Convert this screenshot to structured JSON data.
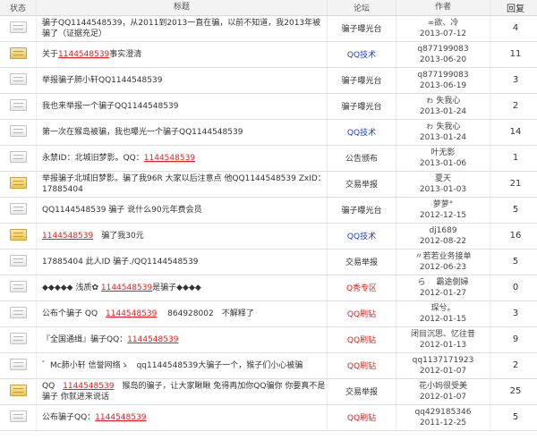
{
  "header": {
    "status": "状态",
    "title": "标题",
    "forum": "论坛",
    "author": "作者",
    "replies": "回复"
  },
  "colors": {
    "highlight": "#e0201e",
    "forum_blue": "#1b3fc8",
    "forum_red": "#e0201e"
  },
  "rows": [
    {
      "icon": "document-icon",
      "title_pre": "骗子QQ1144548539，从2011到2013一直在骗，以前不知道，我2013年被骗了（证据充足）",
      "title_hl": "",
      "title_post": "",
      "forum": "骗子曝光台",
      "forum_color": "dark",
      "author": "∞欲、冷",
      "date": "2013-07-12",
      "replies": "4"
    },
    {
      "icon": "folder-icon",
      "title_pre": "关于",
      "title_hl": "1144548539",
      "title_post": "事实澄清",
      "forum": "QQ技术",
      "forum_color": "blue",
      "author": "q877199083",
      "date": "2013-06-20",
      "replies": "11"
    },
    {
      "icon": "document-icon",
      "title_pre": "举报骗子肺小轩QQ1144548539",
      "title_hl": "",
      "title_post": "",
      "forum": "骗子曝光台",
      "forum_color": "dark",
      "author": "q877199083",
      "date": "2013-06-19",
      "replies": "3"
    },
    {
      "icon": "document-icon",
      "title_pre": "我也来举报一个骗子QQ1144548539",
      "title_hl": "",
      "title_post": "",
      "forum": "骗子曝光台",
      "forum_color": "dark",
      "author": "ゎ 失我心",
      "date": "2013-01-24",
      "replies": "2"
    },
    {
      "icon": "document-icon",
      "title_pre": "第一次在猴岛被骗，我也曝光一个骗子QQ1144548539",
      "title_hl": "",
      "title_post": "",
      "forum": "QQ技术",
      "forum_color": "blue",
      "author": "ゎ 失我心",
      "date": "2013-01-24",
      "replies": "14"
    },
    {
      "icon": "document-icon",
      "title_pre": "永禁ID：北城旧梦影。QQ：",
      "title_hl": "1144548539",
      "title_post": "",
      "forum": "公告颁布",
      "forum_color": "dark",
      "author": "叶无影",
      "date": "2013-01-06",
      "replies": "1"
    },
    {
      "icon": "folder-icon",
      "title_pre": "举报骗子北城旧梦影。骗了我96R 大家以后注意点 他QQ1144548539 ZxID：17885404",
      "title_hl": "",
      "title_post": "",
      "forum": "交易举报",
      "forum_color": "dark",
      "author": "夏天",
      "date": "2013-01-03",
      "replies": "21"
    },
    {
      "icon": "document-icon",
      "title_pre": "QQ1144548539 骗子 说什么90元年费会员",
      "title_hl": "",
      "title_post": "",
      "forum": "骗子曝光台",
      "forum_color": "dark",
      "author": "萝萝°",
      "date": "2012-12-15",
      "replies": "5"
    },
    {
      "icon": "folder-icon",
      "title_pre": "",
      "title_hl": "1144548539",
      "title_post": "　骗了我30元",
      "forum": "QQ技术",
      "forum_color": "blue",
      "author": "dj1689",
      "date": "2012-08-22",
      "replies": "16"
    },
    {
      "icon": "document-icon",
      "title_pre": "17885404 此人ID 骗子./QQ1144548539",
      "title_hl": "",
      "title_post": "",
      "forum": "交易举报",
      "forum_color": "dark",
      "author": "〃若若业务接单",
      "date": "2012-06-23",
      "replies": "5"
    },
    {
      "icon": "document-icon",
      "title_pre": "◆◆◆◆◆ 浅质✿ ",
      "title_hl": "1144548539",
      "title_post": "是骗子◆◆◆◆",
      "forum": "Q秀专区",
      "forum_color": "red",
      "author": "ら　 霸途側婦",
      "date": "2012-01-27",
      "replies": "0"
    },
    {
      "icon": "document-icon",
      "title_pre": "公布个骗子 QQ　",
      "title_hl": "1144548539",
      "title_post": "　 864928002　不解释了",
      "forum": "QQ刷钻",
      "forum_color": "red",
      "author": "琛兮。",
      "date": "2012-01-15",
      "replies": "3"
    },
    {
      "icon": "document-icon",
      "title_pre": "『全国通缉』骗子QQ：",
      "title_hl": "1144548539",
      "title_post": "",
      "forum": "QQ刷钻",
      "forum_color": "red",
      "author": "闭目沉思、忆往昔",
      "date": "2012-01-13",
      "replies": "9"
    },
    {
      "icon": "person-icon",
      "title_pre": "゛Mc肺小轩 信誉网络ゝ　qq1144548539大骗子一个，猴子们小心被骗",
      "title_hl": "",
      "title_post": "",
      "forum": "QQ刷钻",
      "forum_color": "red",
      "author": "qq1137171923",
      "date": "2012-01-07",
      "replies": "2"
    },
    {
      "icon": "folder-icon",
      "title_pre": "QQ　",
      "title_hl": "1144548539",
      "title_post": "　猴岛的骗子，让大家瞅瞅 免得再加你QQ骗你 你要真不是骗子 你就进来说话",
      "forum": "交易举报",
      "forum_color": "dark",
      "author": "花小妈很受美",
      "date": "2012-01-07",
      "replies": "25"
    },
    {
      "icon": "document-icon",
      "title_pre": "公布骗子QQ：",
      "title_hl": "1144548539",
      "title_post": "",
      "forum": "QQ刷钻",
      "forum_color": "red",
      "author": "qq429185346",
      "date": "2011-12-25",
      "replies": "5"
    }
  ]
}
